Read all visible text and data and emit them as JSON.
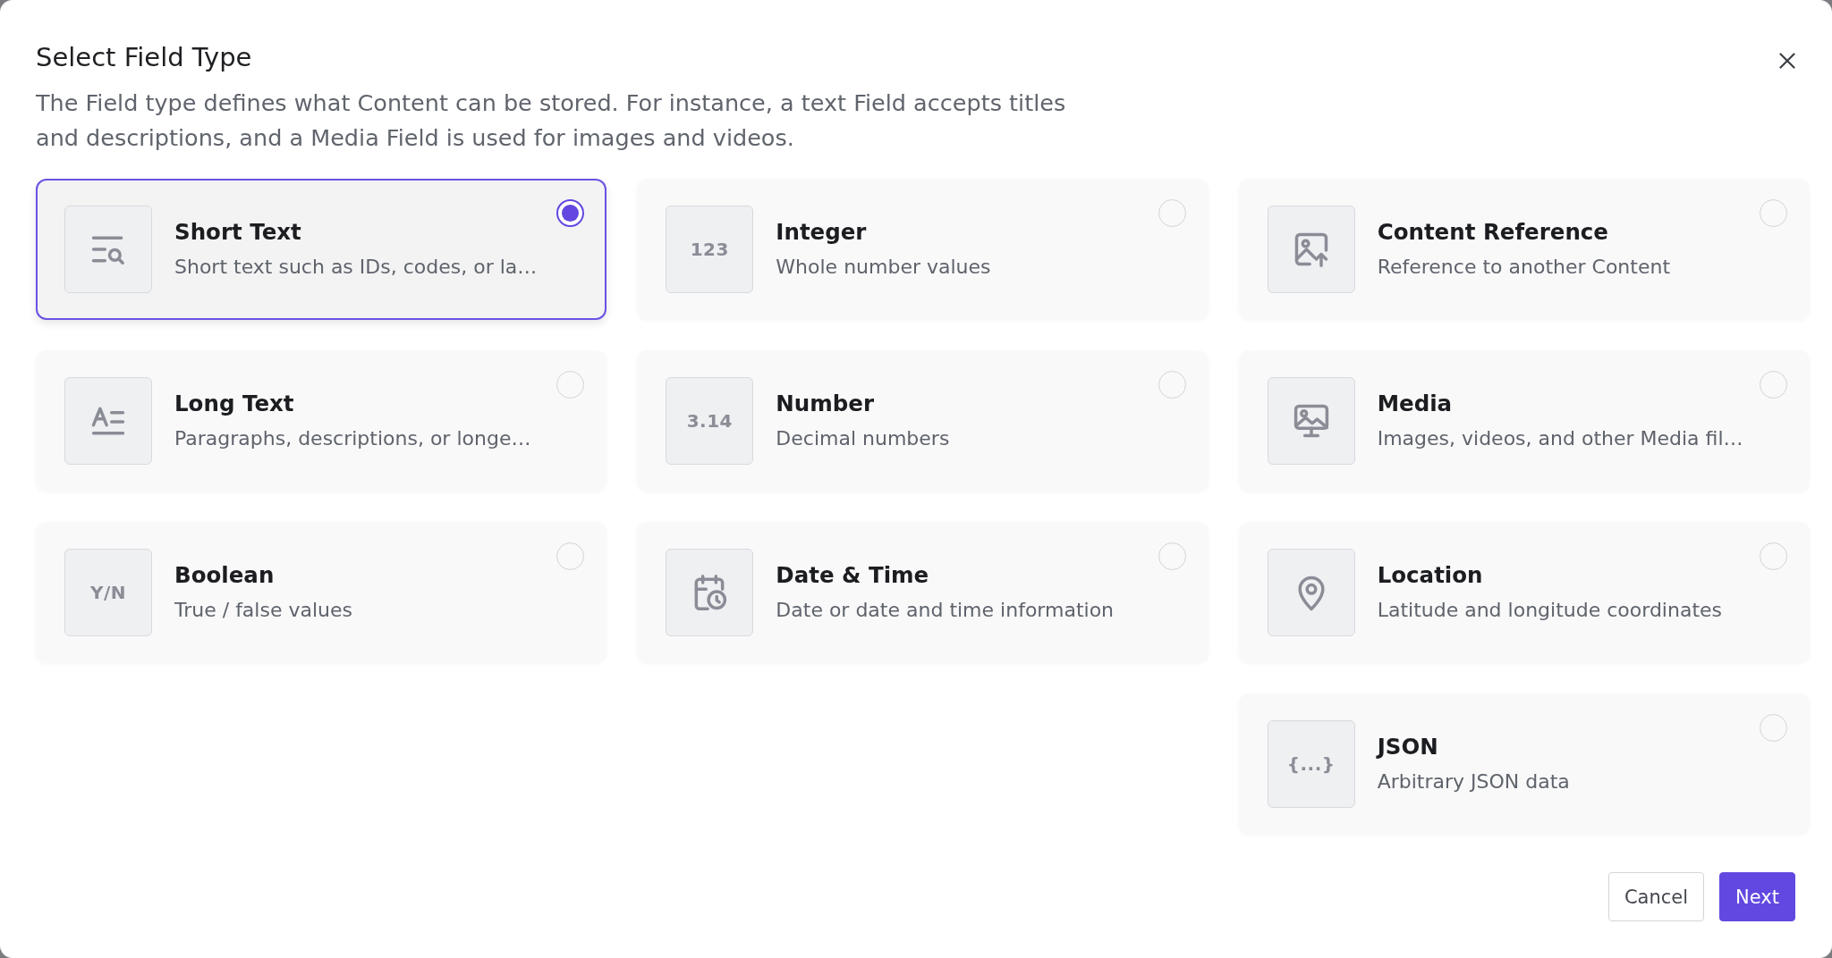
{
  "dialog": {
    "title": "Select Field Type",
    "description": "The Field type defines what Content can be stored. For instance, a text Field accepts titles and descriptions, and a Media Field is used for images and videos."
  },
  "columns": [
    {
      "items": [
        {
          "kind": "search",
          "title": "Short Text",
          "description": "Short text such as IDs, codes, or la…",
          "selected": true
        },
        {
          "kind": "heading",
          "title": "Long Text",
          "description": "Paragraphs, descriptions, or longe…",
          "selected": false
        },
        {
          "kind": "glyph",
          "glyph": "Y/N",
          "title": "Boolean",
          "description": "True / false values",
          "selected": false
        }
      ]
    },
    {
      "items": [
        {
          "kind": "glyph",
          "glyph": "123",
          "title": "Integer",
          "description": "Whole number values",
          "selected": false
        },
        {
          "kind": "glyph",
          "glyph": "3.14",
          "title": "Number",
          "description": "Decimal numbers",
          "selected": false
        },
        {
          "kind": "calendar",
          "title": "Date & Time",
          "description": "Date or date and time information",
          "selected": false
        }
      ]
    },
    {
      "items": [
        {
          "kind": "upload",
          "title": "Content Reference",
          "description": "Reference to another Content",
          "selected": false
        },
        {
          "kind": "display",
          "title": "Media",
          "description": "Images, videos, and other Media fil…",
          "selected": false
        },
        {
          "kind": "pin",
          "title": "Location",
          "description": "Latitude and longitude coordinates",
          "selected": false
        },
        {
          "kind": "glyph",
          "glyph": "{...}",
          "title": "JSON",
          "description": "Arbitrary JSON data",
          "selected": false
        }
      ]
    }
  ],
  "buttons": [
    {
      "kind": "secondary",
      "label": "Cancel"
    },
    {
      "kind": "primary",
      "label": "Next"
    }
  ]
}
